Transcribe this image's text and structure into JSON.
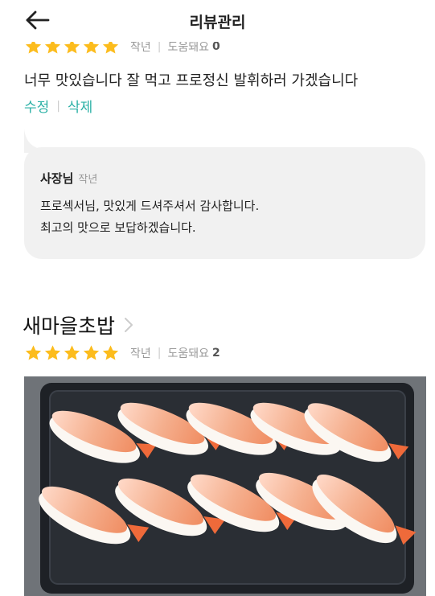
{
  "header": {
    "title": "리뷰관리",
    "back_icon": "arrow-left-icon"
  },
  "review1": {
    "rating": 5,
    "meta_when": "작년",
    "meta_helpful_label": "도움돼요",
    "meta_helpful_count": "0",
    "text": "너무 맛있습니다 잘 먹고 프로정신 발휘하러 가겠습니다",
    "edit_label": "수정",
    "delete_label": "삭제",
    "reply": {
      "owner_label": "사장님",
      "when": "작년",
      "line1": "프로섹서님, 맛있게 드셔주셔서 감사합니다.",
      "line2": "최고의 맛으로 보답하겠습니다."
    }
  },
  "review2": {
    "menu_name": "새마을초밥",
    "rating": 5,
    "meta_when": "작년",
    "meta_helpful_label": "도움돼요",
    "meta_helpful_count": "2",
    "photo_icon": "shrimp-sushi-photo"
  },
  "colors": {
    "star": "#fcbc1d",
    "accent": "#2ab0a5",
    "reply_bg": "#f1f1f1"
  }
}
